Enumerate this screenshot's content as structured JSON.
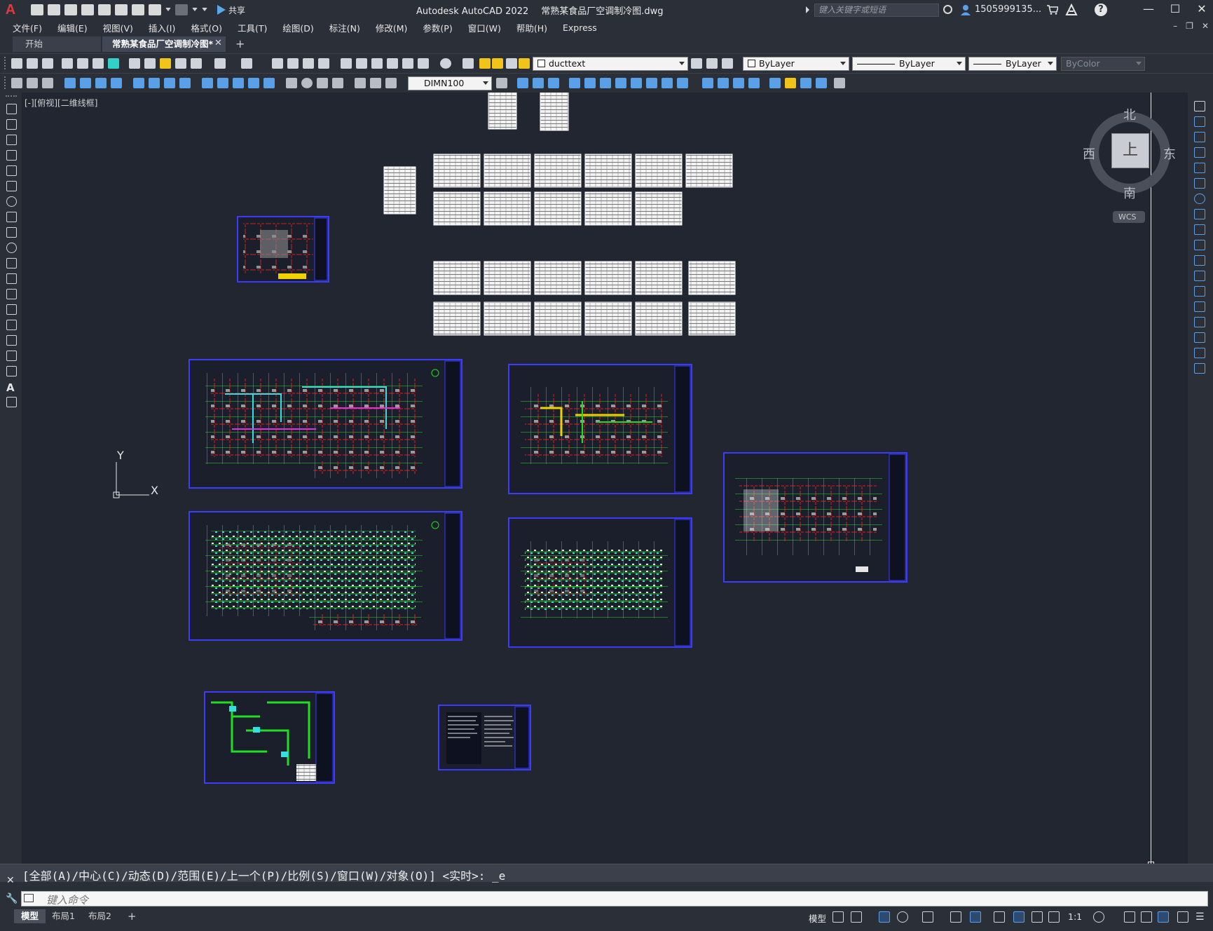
{
  "titlebar": {
    "app_name": "Autodesk AutoCAD 2022",
    "file_name": "常熟某食品厂空调制冷图.dwg",
    "share_label": "共享",
    "search_placeholder": "键入关键字或短语",
    "user_label": "1505999135...",
    "help_label": "?",
    "min_label": "—",
    "max_label": "☐",
    "close_label": "✕"
  },
  "menu": {
    "items": [
      "文件(F)",
      "编辑(E)",
      "视图(V)",
      "插入(I)",
      "格式(O)",
      "工具(T)",
      "绘图(D)",
      "标注(N)",
      "修改(M)",
      "参数(P)",
      "窗口(W)",
      "帮助(H)",
      "Express"
    ]
  },
  "tabs": {
    "start": "开始",
    "drawing": "常熟某食品厂空调制冷图*",
    "close": "✕",
    "add": "+"
  },
  "toolbar": {
    "layer_combo": "ducttext",
    "color_combo": "ByLayer",
    "linetype_combo": "ByLayer",
    "lineweight_combo": "ByLayer",
    "plotstyle_combo": "ByColor",
    "dimstyle_combo": "DIMN100"
  },
  "viewport": {
    "view_label": "[-][俯视][二维线框]",
    "ucs_y": "Y",
    "ucs_x": "X"
  },
  "viewcube": {
    "north": "北",
    "south": "南",
    "west": "西",
    "east": "东",
    "face_label": "上",
    "wcs_label": "WCS"
  },
  "command": {
    "history": "[全部(A)/中心(C)/动态(D)/范围(E)/上一个(P)/比例(S)/窗口(W)/对象(O)] <实时>: _e",
    "placeholder": "键入命令",
    "close": "✕"
  },
  "layout_tabs": {
    "model": "模型",
    "layout1": "布局1",
    "layout2": "布局2",
    "add": "+"
  },
  "statusbar": {
    "model_label": "模型",
    "scale_label": "1:1"
  },
  "colors": {
    "background": "#212631",
    "chrome": "#2b2f38",
    "sheet_border": "#3c3cff",
    "grid_green": "#22dd22",
    "wall_red": "#e02020",
    "accent_blue": "#5aa0e8"
  }
}
